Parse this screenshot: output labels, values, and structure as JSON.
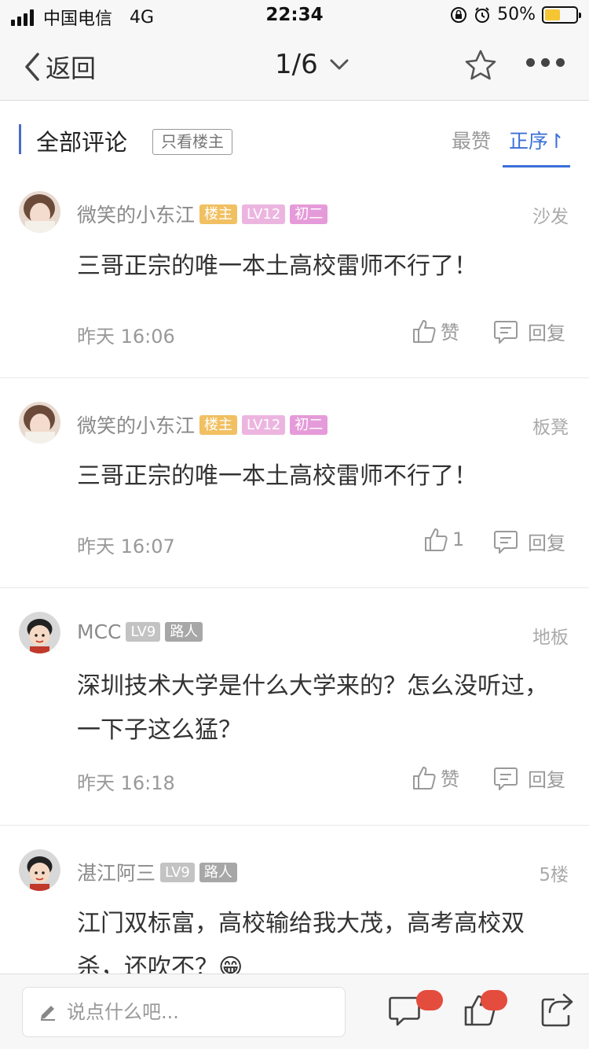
{
  "status_bar": {
    "carrier": "中国电信",
    "network": "4G",
    "time": "22:34",
    "battery": "50%",
    "battery_level": 0.5
  },
  "nav": {
    "back_label": "返回",
    "page_indicator": "1/6"
  },
  "comments_header": {
    "title": "全部评论",
    "filter_label": "只看楼主",
    "sort_likes": "最赞",
    "sort_order": "正序↾"
  },
  "comments": [
    {
      "author": "微笑的小东江",
      "badges": [
        "楼主",
        "LV12",
        "初二"
      ],
      "floor": "沙发",
      "content": "三哥正宗的唯一本土高校雷师不行了！",
      "time": "昨天 16:06",
      "like_label": "赞",
      "reply_label": "回复"
    },
    {
      "author": "微笑的小东江",
      "badges": [
        "楼主",
        "LV12",
        "初二"
      ],
      "floor": "板凳",
      "content": "三哥正宗的唯一本土高校雷师不行了！",
      "time": "昨天 16:07",
      "like_label": "1",
      "reply_label": "回复"
    },
    {
      "author": "MCC",
      "badges": [
        "LV9",
        "路人"
      ],
      "floor": "地板",
      "content": "深圳技术大学是什么大学来的？怎么没听过，一下子这么猛？",
      "time": "昨天 16:18",
      "like_label": "赞",
      "reply_label": "回复"
    },
    {
      "author": "湛江阿三",
      "badges": [
        "LV9",
        "路人"
      ],
      "floor": "5楼",
      "content": "江门双标富，高校输给我大茂，高考高校双杀，还吹不？😁"
    }
  ],
  "bottom_bar": {
    "input_placeholder": "说点什么吧..."
  },
  "colors": {
    "accent": "#3b6fd8",
    "badge_op": "#f1c062",
    "badge_pink": "#e59bd9",
    "badge_grey": "#a7a7a7",
    "notification_red": "#e44c3d"
  },
  "icons": [
    "back-chevron-icon",
    "dropdown-chevron-icon",
    "star-icon",
    "more-icon",
    "thumbs-up-icon",
    "reply-bubble-icon",
    "pencil-icon",
    "comment-icon",
    "like-icon",
    "share-icon"
  ]
}
